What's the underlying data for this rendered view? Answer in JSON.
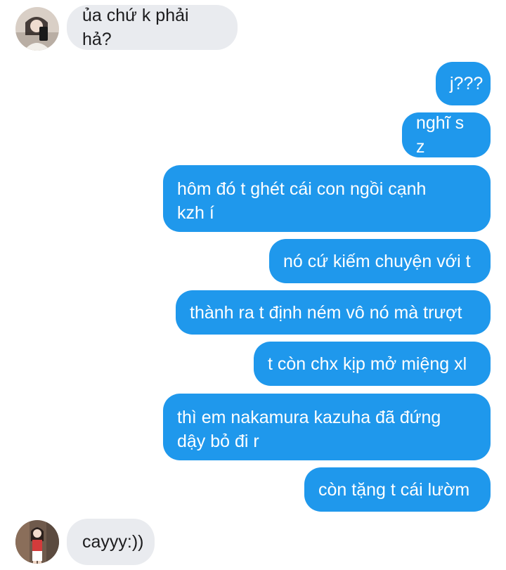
{
  "conversation": {
    "messages": [
      {
        "direction": "incoming",
        "text": "ủa chứ k phải hả?"
      },
      {
        "direction": "outgoing",
        "text": "j???"
      },
      {
        "direction": "outgoing",
        "text": "nghĩ s z"
      },
      {
        "direction": "outgoing",
        "text": "hôm đó t ghét cái con ngồi cạnh\nkzh í"
      },
      {
        "direction": "outgoing",
        "text": "nó cứ kiếm chuyện với t"
      },
      {
        "direction": "outgoing",
        "text": "thành ra t định ném vô nó mà trượt"
      },
      {
        "direction": "outgoing",
        "text": "t còn chx kịp mở miệng xl"
      },
      {
        "direction": "outgoing",
        "text": "thì em nakamura kazuha đã đứng\ndậy bỏ đi r"
      },
      {
        "direction": "outgoing",
        "text": "còn tặng t cái lườm"
      },
      {
        "direction": "incoming",
        "text": "cayyy:))"
      }
    ]
  },
  "colors": {
    "outgoing_bubble": "#1f98ec",
    "incoming_bubble": "#e9ebef",
    "background": "#ffffff"
  }
}
